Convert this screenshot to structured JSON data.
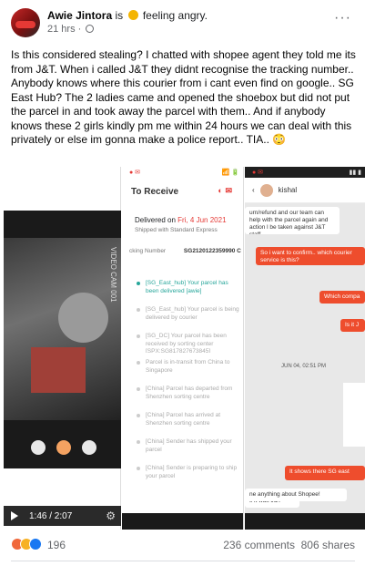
{
  "post": {
    "author": "Awie Jintora",
    "feeling_prefix": "is",
    "feeling": "feeling angry.",
    "time": "21 hrs ·",
    "more_label": "···",
    "text": "Is this considered stealing? I chatted with shopee agent they told me its from J&T. When i called J&T they didnt recognise the tracking number.. Anybody knows where this courier from i cant even find on google.. SG East Hub? The 2 ladies came and opened the shoebox but did not put the parcel in and took away the parcel with them.. And if anybody knows these 2 girls kindly pm me within 24 hours we can deal with this privately or else im gonna make a police report.. TIA.. 😳"
  },
  "video": {
    "time": "1:46 / 2:07",
    "side_label": "VIDEO CAM 001"
  },
  "receipt": {
    "status_time": "📶 🔋",
    "title": "To Receive",
    "delivered_label": "Delivered on",
    "delivered_date": "Fri, 4 Jun 2021",
    "shipped_with": "Shipped with Standard Express",
    "tracking_label": "cking Number",
    "tracking_value": "SG2120122359990 C",
    "events": [
      "[SG_East_hub] Your parcel has been delivered [awie]",
      "[SG_East_hub] Your parcel is being delivered by courier",
      "[SG_DC] Your parcel has been received by sorting center [SPX:SG817827673845]",
      "Parcel is in-transit from China to Singapore",
      "[China] Parcel has departed from Shenzhen sorting centre",
      "[China] Parcel has arrived at Shenzhen sorting centre",
      "[China] Sender has shipped your parcel",
      "[China] Sender is preparing to ship your parcel"
    ]
  },
  "chat": {
    "contact": "kishal",
    "messages": {
      "m1": "urn/refund and our team can help with the parcel again and action l be taken against J&T staff",
      "m2": "So i want to confirm.. which courier service is this?",
      "m3": "Which compa",
      "m4": "Is it J",
      "timestamp": "JUN 04, 02:51 PM",
      "m5": "It shows there SG east",
      "m6": "s it was J&T",
      "m7": "ne anything about Shopee!"
    }
  },
  "stats": {
    "reactions_count": "196",
    "comments": "236 comments",
    "shares": "806 shares"
  }
}
